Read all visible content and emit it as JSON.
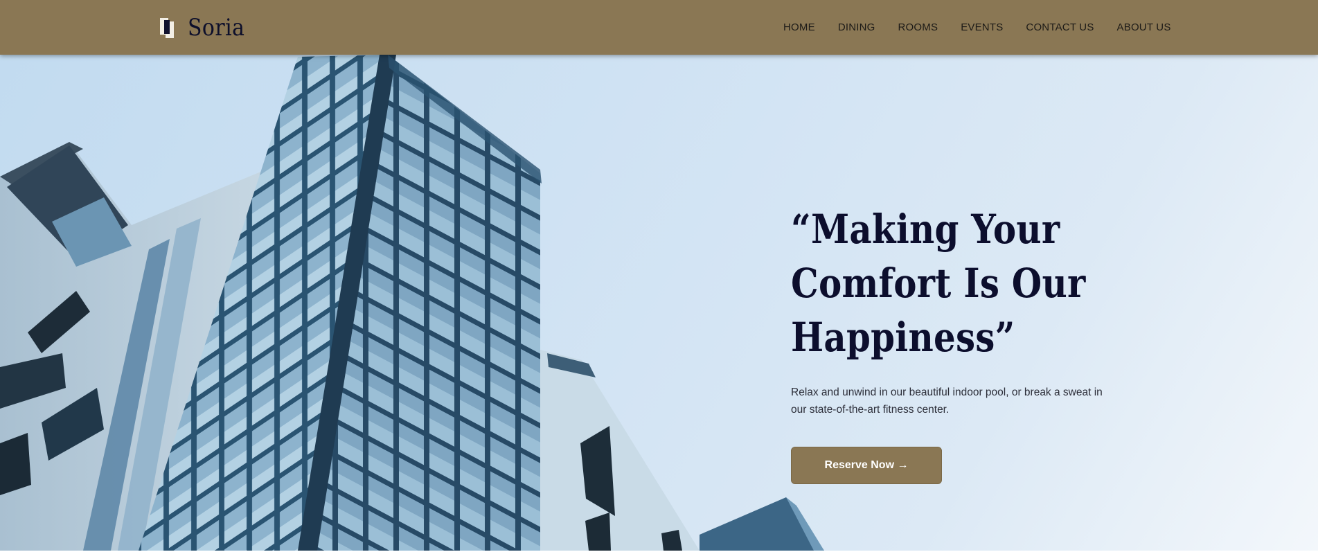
{
  "brand": {
    "name": "Soria",
    "logo_icon": "stacked-squares-logo-icon"
  },
  "nav": {
    "items": [
      {
        "label": "HOME"
      },
      {
        "label": "DINING"
      },
      {
        "label": "ROOMS"
      },
      {
        "label": "EVENTS"
      },
      {
        "label": "CONTACT US"
      },
      {
        "label": "ABOUT US"
      }
    ]
  },
  "hero": {
    "headline_lines": [
      "“Making Your",
      "Comfort Is Our",
      "Happiness”"
    ],
    "subtext": "Relax and unwind in our beautiful indoor pool, or break a sweat in our state-of-the-art fitness center.",
    "cta_label": "Reserve Now →",
    "background_image": "modern-glass-building-photo"
  },
  "colors": {
    "nav_background": "#8a7754",
    "headline": "#0c0e2d",
    "button": "#8a7754",
    "sky": "#cfe2f3"
  }
}
